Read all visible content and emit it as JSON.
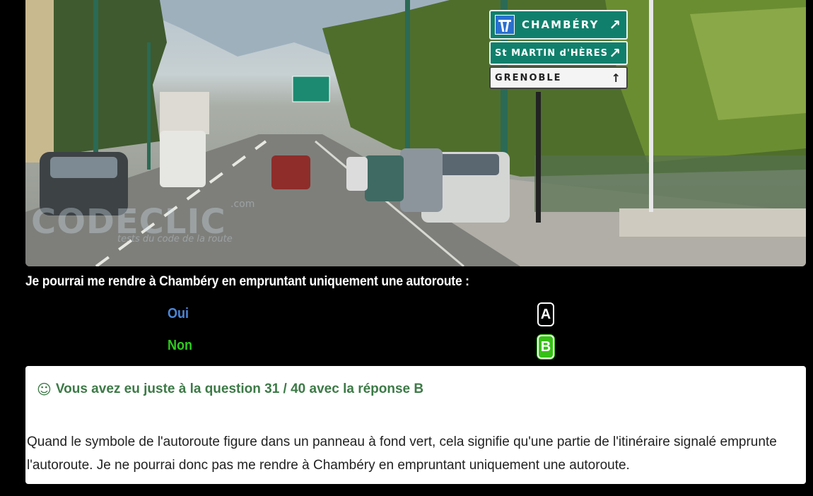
{
  "photo": {
    "signs": [
      {
        "label": "CHAMBÉRY",
        "arrow": "↗",
        "style": "green",
        "motorway_icon": true
      },
      {
        "label": "St MARTIN d'HÈRES",
        "arrow": "↗",
        "style": "green",
        "motorway_icon": false
      },
      {
        "label": "GRENOBLE",
        "arrow": "↑",
        "style": "white",
        "motorway_icon": false
      }
    ],
    "watermark": {
      "text": "CODECLIC",
      "domain": ".com",
      "tagline": "tests du code de la route"
    }
  },
  "question": {
    "text": "Je pourrai me rendre à Chambéry en empruntant uniquement une autoroute :"
  },
  "answers": [
    {
      "label": "Oui",
      "letter": "A",
      "color": "#4a86d8",
      "selected": false
    },
    {
      "label": "Non",
      "letter": "B",
      "color": "#2ecc1e",
      "selected": true
    }
  ],
  "result": {
    "icon": "smiley-icon",
    "text": "Vous avez eu juste à la question 31 / 40 avec la réponse B",
    "explanation": "Quand le symbole de l'autoroute figure dans un panneau à fond vert, cela signifie qu'une partie de l'itinéraire signalé emprunte l'autoroute. Je ne pourrai donc pas me rendre à Chambéry en empruntant uniquement une autoroute.",
    "text_color": "#3c7a46"
  }
}
